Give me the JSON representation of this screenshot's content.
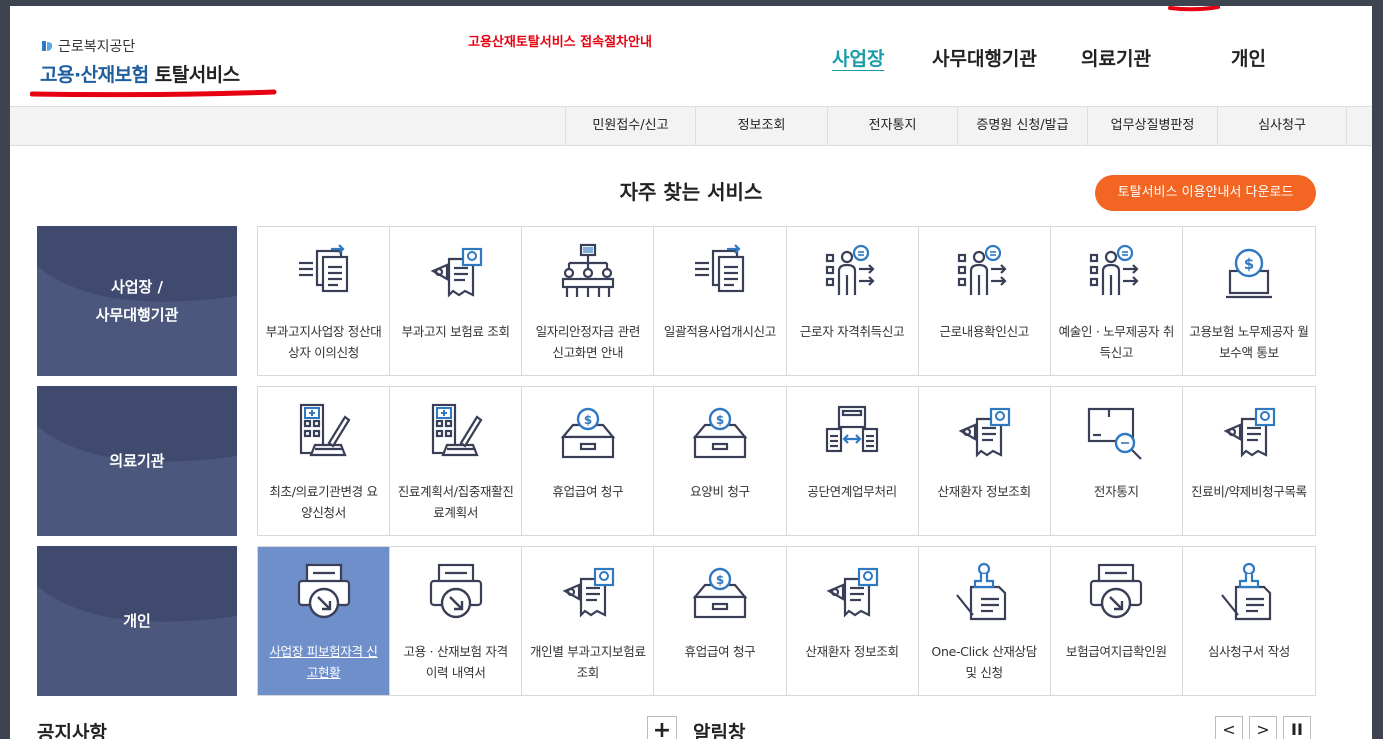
{
  "header": {
    "org_name": "근로복지공단",
    "title_part1": "고용·산재보험",
    "title_part2": "토탈서비스",
    "guide_link": "고용산재토탈서비스 접속절차안내"
  },
  "topnav": [
    {
      "label": "사업장",
      "active": true
    },
    {
      "label": "사무대행기관"
    },
    {
      "label": "의료기관"
    },
    {
      "label": "개인"
    }
  ],
  "subnav": [
    "민원접수/신고",
    "정보조회",
    "전자통지",
    "증명원 신청/발급",
    "업무상질병판정",
    "심사청구"
  ],
  "main": {
    "section_title": "자주 찾는 서비스",
    "download_button": "토탈서비스 이용안내서 다운로드"
  },
  "rows": [
    {
      "label": "사업장 /\n사무대행기관",
      "tiles": [
        {
          "label": "부과고지사업장 정산대상자 이의신청",
          "icon": "document-list-icon"
        },
        {
          "label": "부과고지 보험료 조회",
          "icon": "document-search-icon"
        },
        {
          "label": "일자리안정자금 관련 신고화면 안내",
          "icon": "org-chart-icon"
        },
        {
          "label": "일괄적용사업개시신고",
          "icon": "document-list-icon"
        },
        {
          "label": "근로자 자격취득신고",
          "icon": "person-list-icon"
        },
        {
          "label": "근로내용확인신고",
          "icon": "person-list-icon"
        },
        {
          "label": "예술인 · 노무제공자 취득신고",
          "icon": "person-list-icon"
        },
        {
          "label": "고용보험 노무제공자 월보수액 통보",
          "icon": "money-monitor-icon"
        }
      ]
    },
    {
      "label": "의료기관",
      "tiles": [
        {
          "label": "최초/의료기관변경 요양신청서",
          "icon": "hospital-pen-icon"
        },
        {
          "label": "진료계획서/집중재활진료계획서",
          "icon": "hospital-pen-icon"
        },
        {
          "label": "휴업급여 청구",
          "icon": "money-box-icon"
        },
        {
          "label": "요양비 청구",
          "icon": "money-box-icon"
        },
        {
          "label": "공단연계업무처리",
          "icon": "document-exchange-icon"
        },
        {
          "label": "산재환자 정보조회",
          "icon": "document-search-icon"
        },
        {
          "label": "전자통지",
          "icon": "mail-search-icon"
        },
        {
          "label": "진료비/약제비청구목록",
          "icon": "document-search-icon"
        }
      ]
    },
    {
      "label": "개인",
      "tiles": [
        {
          "label": "사업장 피보험자격 신고현황",
          "icon": "printer-download-icon",
          "highlight": true
        },
        {
          "label": "고용 · 산재보험 자격 이력 내역서",
          "icon": "printer-download-icon"
        },
        {
          "label": "개인별 부과고지보험료 조회",
          "icon": "document-search-icon"
        },
        {
          "label": "휴업급여 청구",
          "icon": "money-box-icon"
        },
        {
          "label": "산재환자 정보조회",
          "icon": "document-search-icon"
        },
        {
          "label": "One-Click 산재상담 및 신청",
          "icon": "stamp-document-icon"
        },
        {
          "label": "보험급여지급확인원",
          "icon": "printer-download-icon"
        },
        {
          "label": "심사청구서 작성",
          "icon": "stamp-document-icon"
        }
      ]
    }
  ],
  "bottom": {
    "notice_title": "공지사항",
    "alert_title": "알림창",
    "plus_label": "+",
    "prev_label": "<",
    "next_label": ">",
    "pause_label": "II"
  },
  "colors": {
    "accent": "#1a9ca8",
    "logo_blue": "#1e5e9f",
    "row_label_bg": "#3f4a6e",
    "download_button_bg": "#f26522",
    "highlight_tile": "#6f8fcb",
    "icon_stroke": "#3a3f58",
    "icon_accent": "#2f78c2"
  }
}
